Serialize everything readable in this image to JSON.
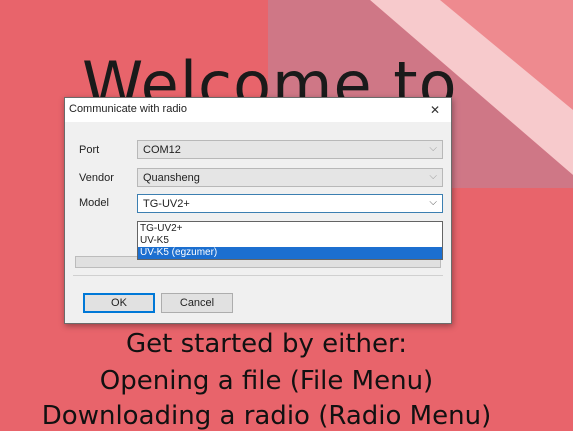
{
  "background": {
    "welcome_text": "Welcome to",
    "lines": [
      "Get started by either:",
      "Opening a file (File Menu)",
      "Downloading a radio (Radio Menu)"
    ]
  },
  "dialog": {
    "title": "Communicate with radio",
    "close_glyph": "✕",
    "fields": {
      "port": {
        "label": "Port",
        "value": "COM12"
      },
      "vendor": {
        "label": "Vendor",
        "value": "Quansheng"
      },
      "model": {
        "label": "Model",
        "value": "TG-UV2+"
      }
    },
    "model_options": [
      "TG-UV2+",
      "UV-K5",
      "UV-K5 (egzumer)"
    ],
    "model_selected_index": 2,
    "ok_label": "OK",
    "cancel_label": "Cancel"
  },
  "colors": {
    "background": "#e8646b",
    "accent": "#1c6fd0"
  }
}
